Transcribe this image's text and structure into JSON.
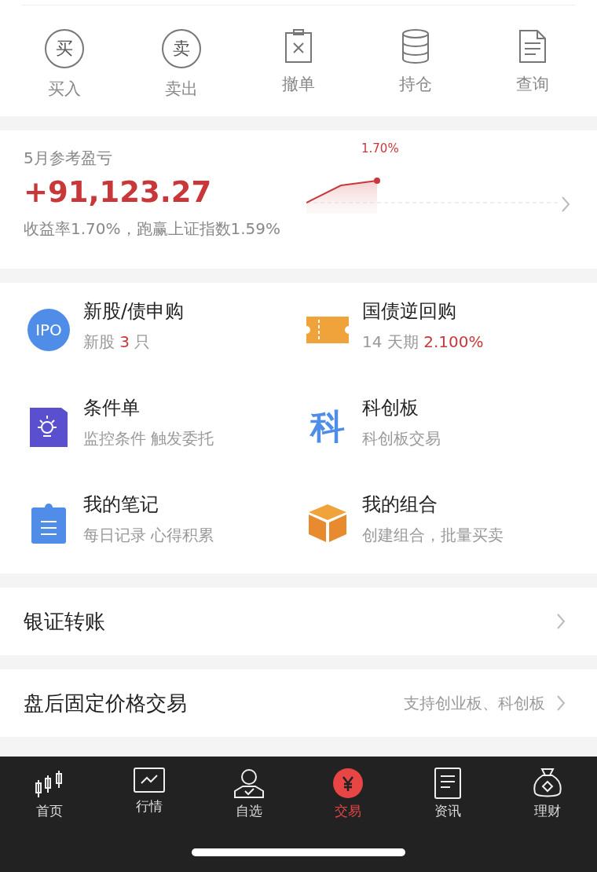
{
  "quick_actions": [
    {
      "kind": "circle",
      "glyph": "买",
      "label": "买入"
    },
    {
      "kind": "circle",
      "glyph": "卖",
      "label": "卖出"
    },
    {
      "kind": "cancel",
      "label": "撤单"
    },
    {
      "kind": "stack",
      "label": "持仓"
    },
    {
      "kind": "doc",
      "label": "查询"
    }
  ],
  "profit": {
    "title": "5月参考盈亏",
    "amount": "+91,123.27",
    "summary": "收益率1.70%，跑赢上证指数1.59%",
    "chart_label": "1.70%"
  },
  "services": [
    {
      "kind": "ipo",
      "icon_text": "IPO",
      "title": "新股/债申购",
      "subtitle": "新股 **3** 只"
    },
    {
      "kind": "ticket",
      "title": "国债逆回购",
      "subtitle": "14 天期  **2.100%**"
    },
    {
      "kind": "alert",
      "title": "条件单",
      "subtitle": "监控条件 触发委托"
    },
    {
      "kind": "star",
      "icon_text": "科",
      "title": "科创板",
      "subtitle": "科创板交易"
    },
    {
      "kind": "note",
      "title": "我的笔记",
      "subtitle": "每日记录 心得积累"
    },
    {
      "kind": "box",
      "title": "我的组合",
      "subtitle": "创建组合，批量买卖"
    }
  ],
  "links": [
    {
      "label": "银证转账"
    },
    {
      "label": "盘后固定价格交易",
      "hint": "支持创业板、科创板"
    }
  ],
  "tab_bar": [
    {
      "kind": "candles",
      "label": "首页",
      "selected": false
    },
    {
      "kind": "chart",
      "label": "行情",
      "selected": false
    },
    {
      "kind": "person",
      "label": "自选",
      "selected": false
    },
    {
      "kind": "yuan",
      "label": "交易",
      "selected": true
    },
    {
      "kind": "news",
      "label": "资讯",
      "selected": false
    },
    {
      "kind": "bag",
      "label": "理财",
      "selected": false
    }
  ]
}
